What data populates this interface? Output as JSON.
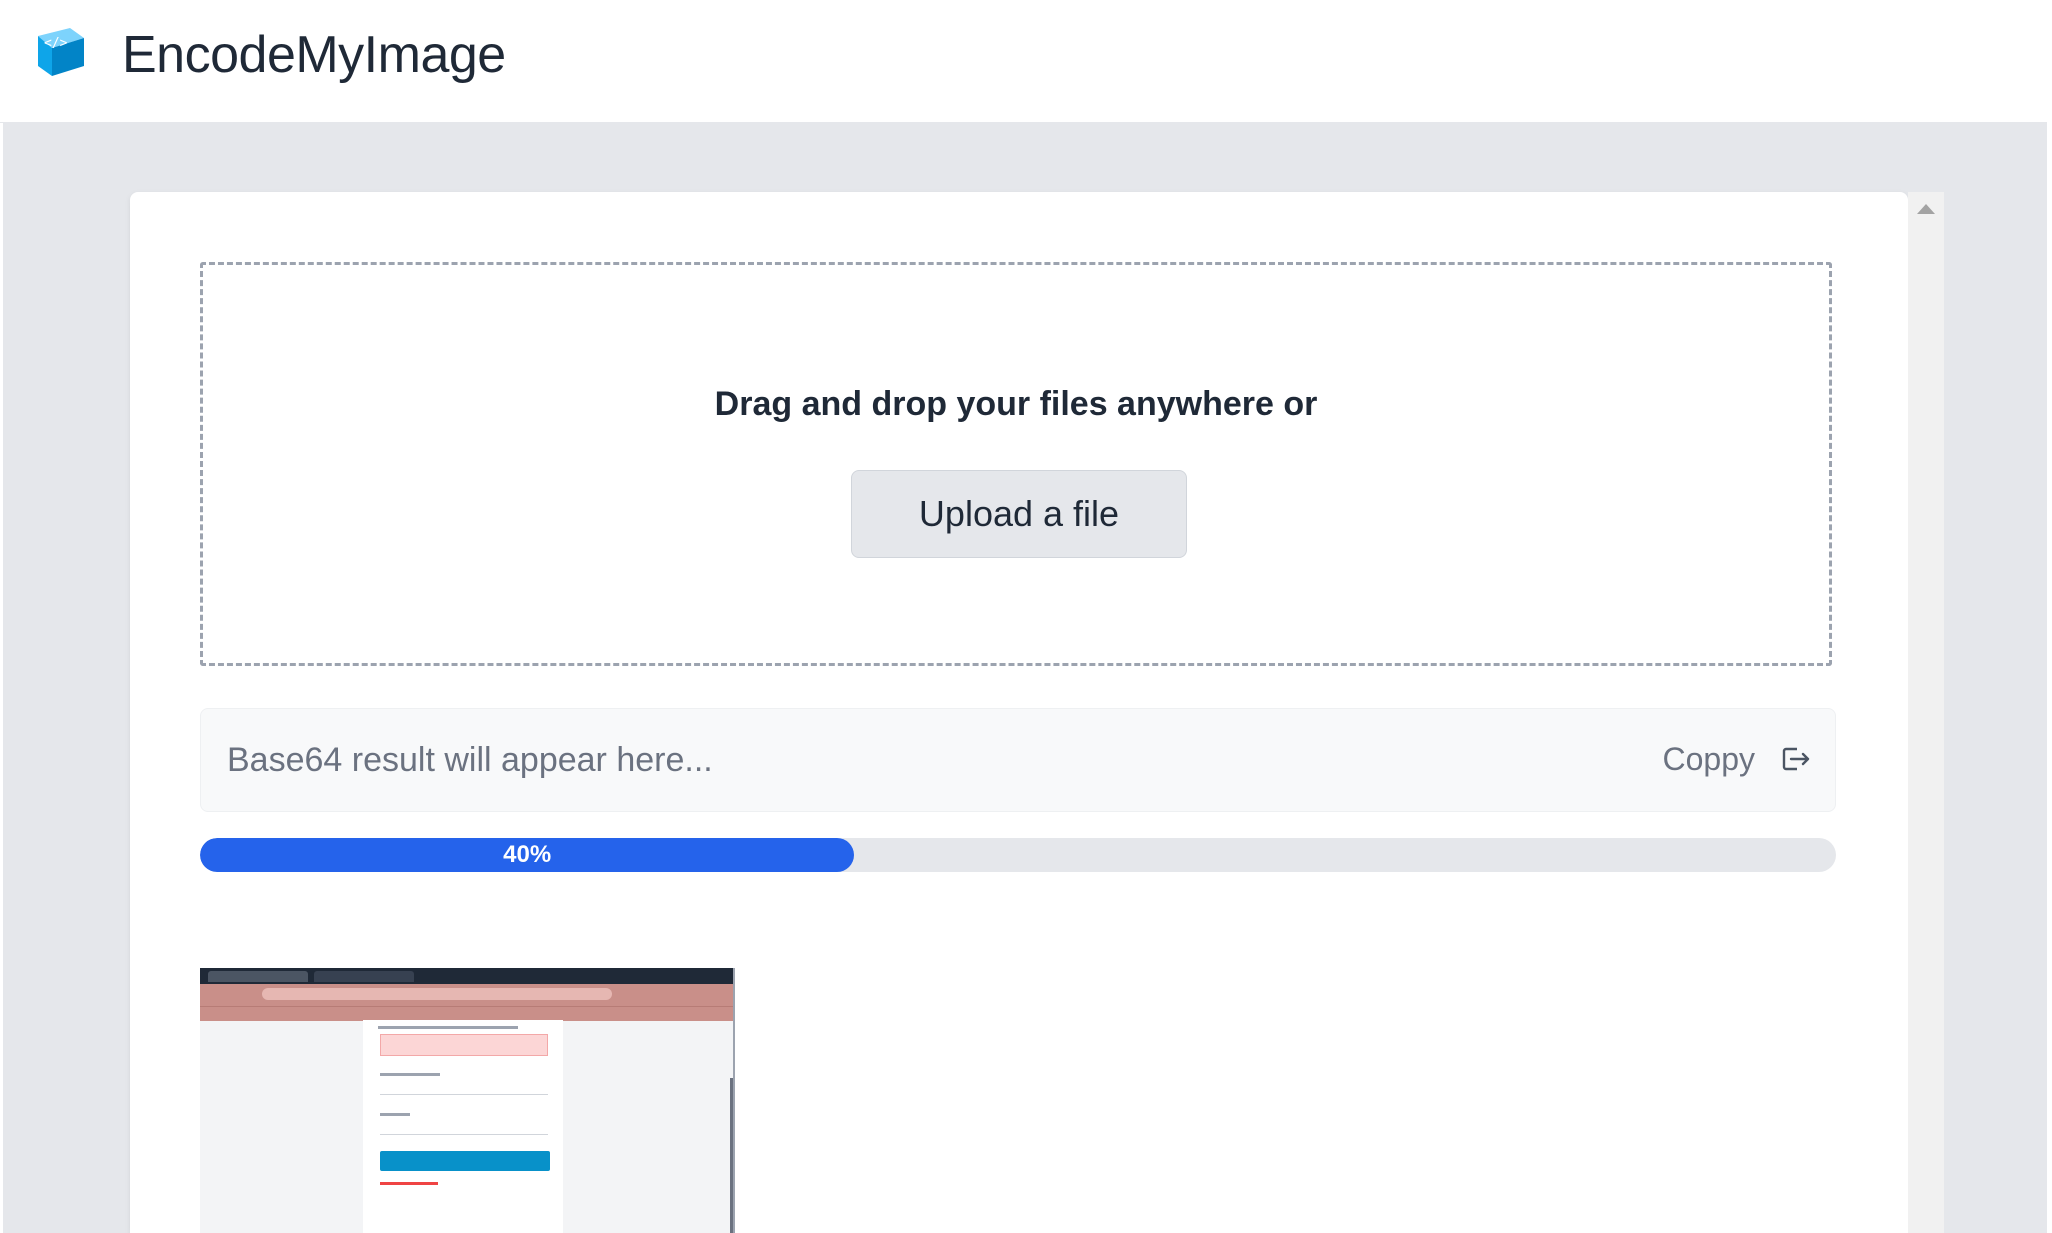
{
  "app": {
    "title": "EncodeMyImage",
    "logo_icon": "code-cube-icon"
  },
  "dropzone": {
    "prompt": "Drag and drop your files anywhere or",
    "upload_label": "Upload a file"
  },
  "result": {
    "placeholder": "Base64 result will appear here...",
    "copy_label": "Coppy",
    "copy_icon": "copy-icon"
  },
  "progress": {
    "percent": 40,
    "label": "40%"
  },
  "preview": {
    "icon": "image-preview-thumbnail"
  },
  "colors": {
    "accent": "#2563eb",
    "background": "#e5e7eb",
    "text": "#1f2937",
    "muted": "#6b7280"
  }
}
